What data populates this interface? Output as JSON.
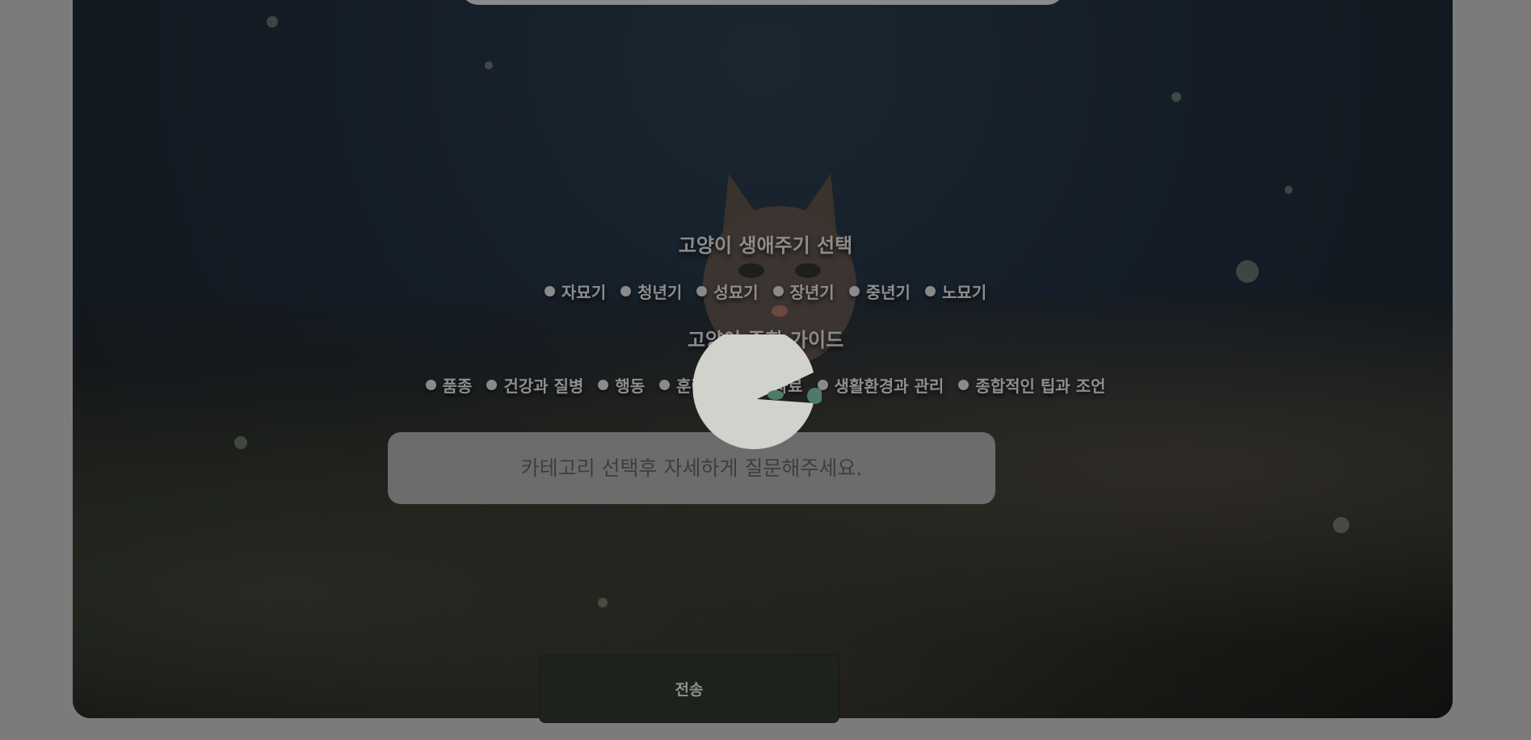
{
  "lifecycle": {
    "title": "고양이 생애주기 선택",
    "options": [
      "자묘기",
      "청년기",
      "성묘기",
      "장년기",
      "중년기",
      "노묘기"
    ]
  },
  "guide": {
    "title": "고양이 종합 가이드",
    "options": [
      "품종",
      "건강과 질병",
      "행동",
      "훈련과 양",
      "사료",
      "생활환경과 관리",
      "종합적인 팁과 조언"
    ]
  },
  "question": {
    "placeholder": "카테고리 선택후 자세하게 질문해주세요."
  },
  "submit": {
    "label": "전송"
  },
  "colors": {
    "overlay": "#7b7b7b",
    "loader_face": "#d2d2cc",
    "loader_dot": "#4f7a6a"
  }
}
